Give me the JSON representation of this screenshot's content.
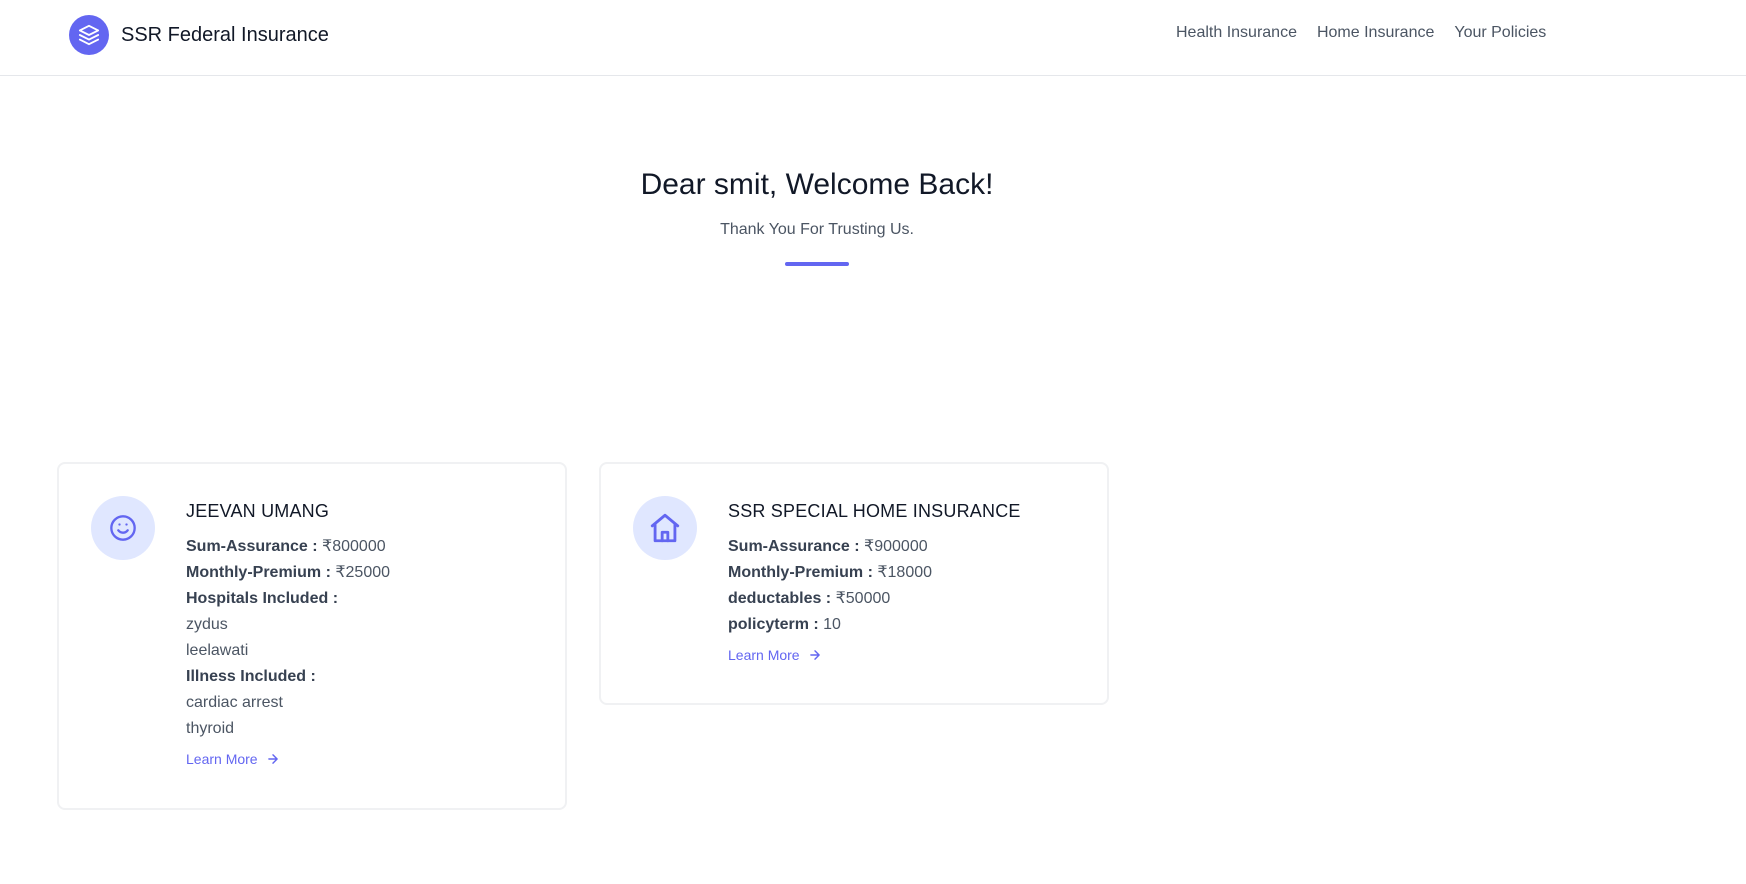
{
  "header": {
    "brand_name": "SSR Federal Insurance",
    "logo_icon": "layers-icon",
    "nav": [
      {
        "label": "Health Insurance"
      },
      {
        "label": "Home Insurance"
      },
      {
        "label": "Your Policies"
      }
    ]
  },
  "hero": {
    "title": "Dear smit, Welcome Back!",
    "subtitle": "Thank You For Trusting Us."
  },
  "colors": {
    "accent": "#6366f1",
    "icon_bg": "#e0e7ff",
    "heading": "#111827",
    "text": "#4b5563"
  },
  "policies": [
    {
      "icon": "smiley-face-icon",
      "title": "JEEVAN UMANG",
      "sum_label": "Sum-Assurance :",
      "sum_value": "₹800000",
      "premium_label": "Monthly-Premium :",
      "premium_value": "₹25000",
      "hospitals_label": "Hospitals Included :",
      "hospitals": [
        "zydus",
        "leelawati"
      ],
      "illness_label": "Illness Included :",
      "illnesses": [
        "cardiac arrest",
        "thyroid"
      ],
      "learn_more": "Learn More"
    },
    {
      "icon": "home-icon",
      "title": "SSR SPECIAL HOME INSURANCE",
      "sum_label": "Sum-Assurance :",
      "sum_value": "₹900000",
      "premium_label": "Monthly-Premium :",
      "premium_value": "₹18000",
      "deductables_label": "deductables :",
      "deductables_value": "₹50000",
      "policyterm_label": "policyterm :",
      "policyterm_value": "10",
      "learn_more": "Learn More"
    }
  ]
}
